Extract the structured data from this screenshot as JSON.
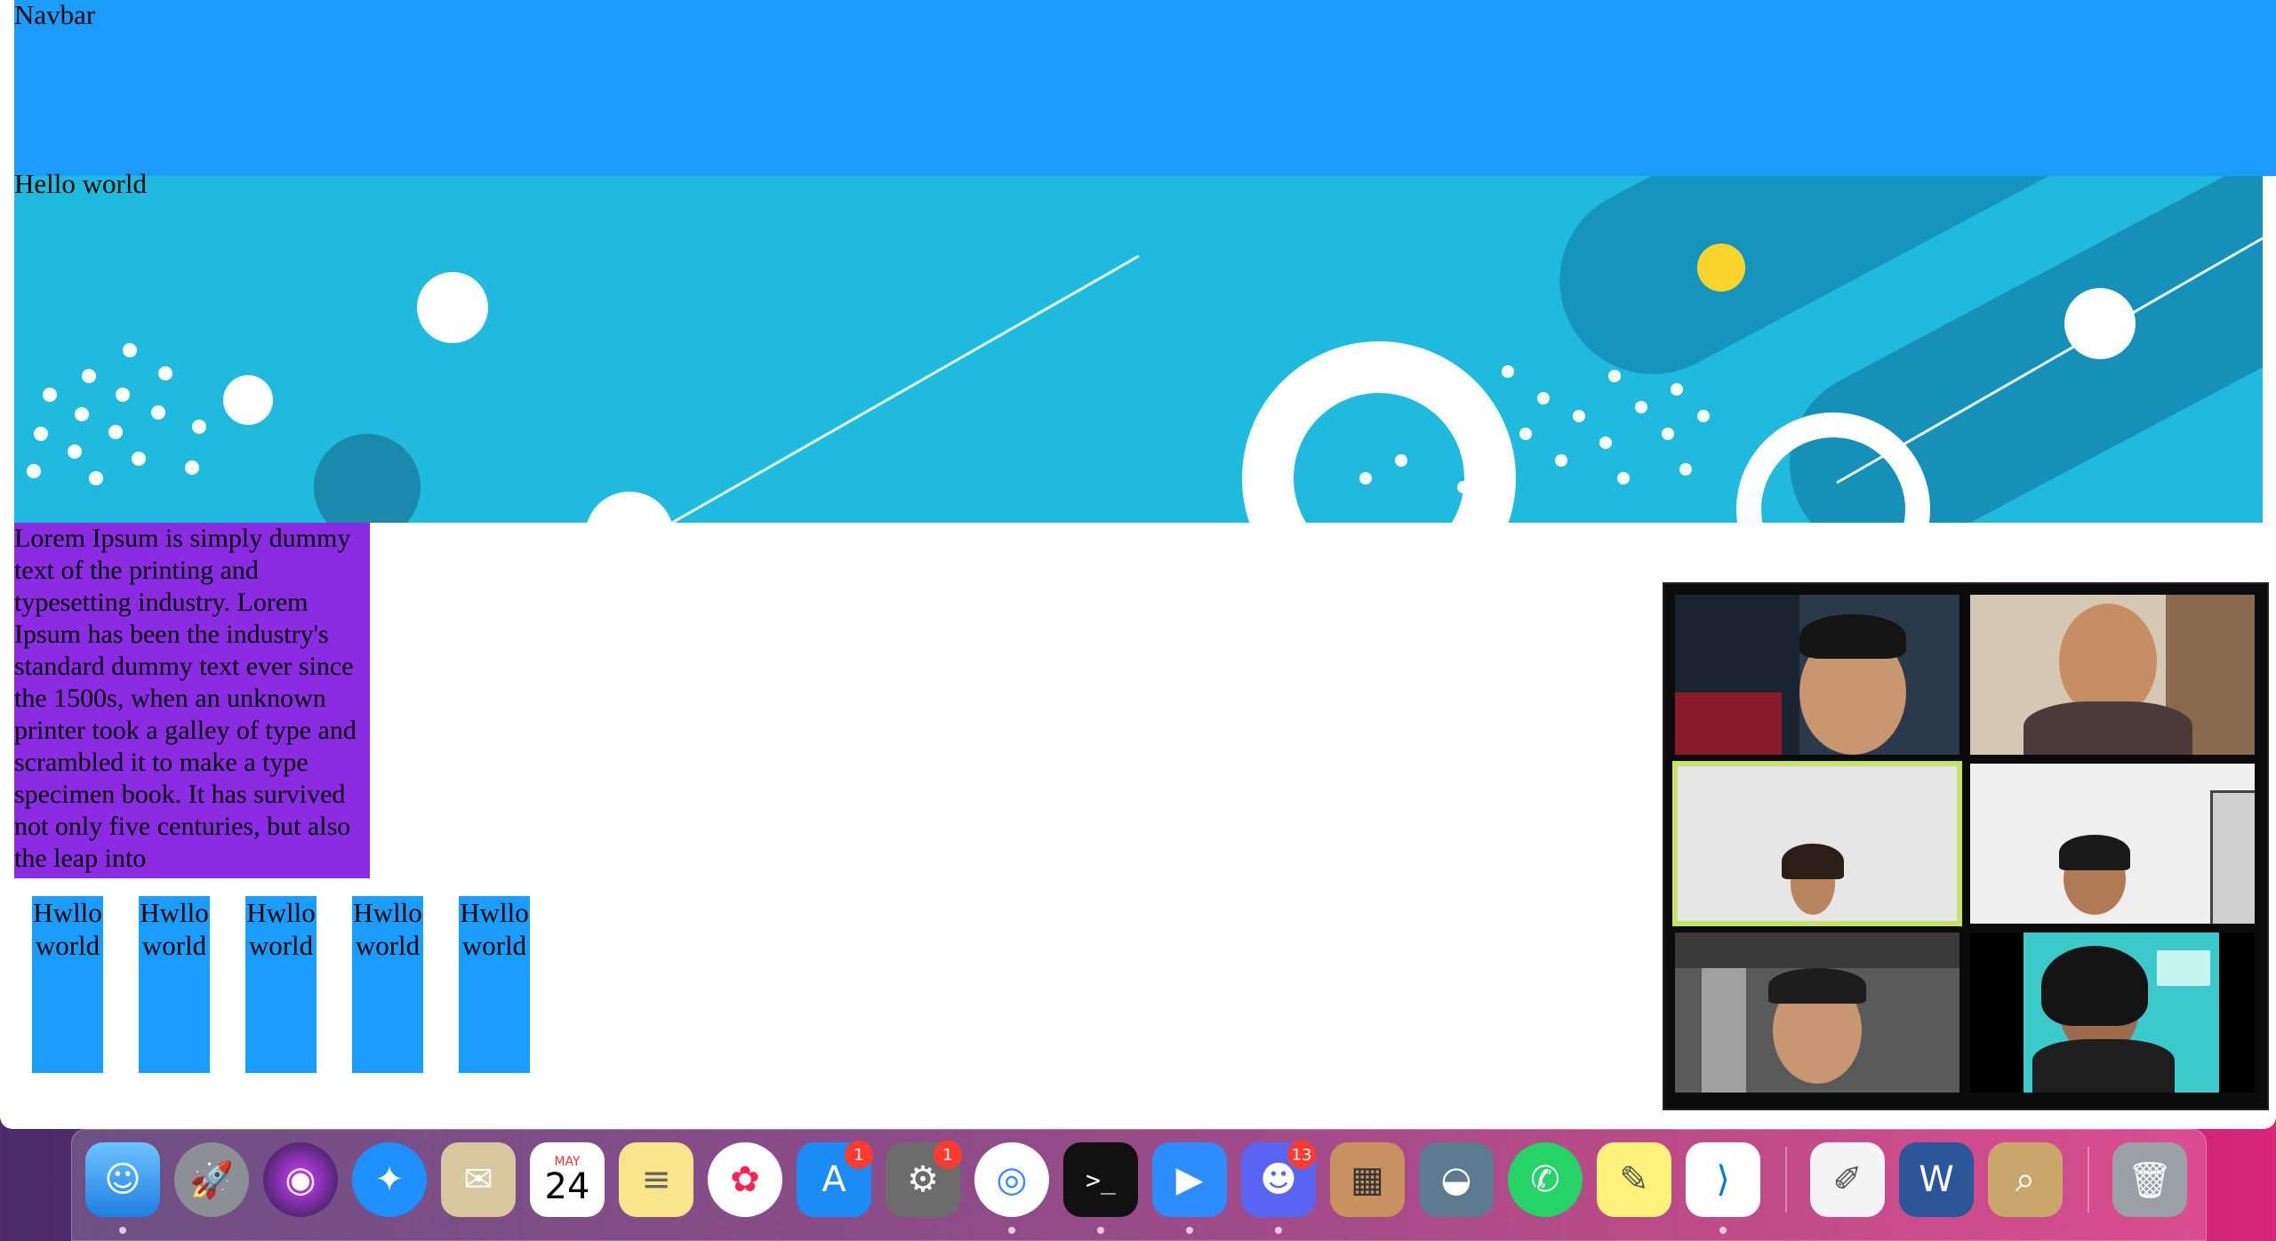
{
  "navbar": {
    "label": "Navbar"
  },
  "hero": {
    "caption": "Hello world"
  },
  "lorem": {
    "text": "Lorem Ipsum is simply dummy text of the printing and typesetting industry. Lorem Ipsum has been the industry's standard dummy text ever since the 1500s, when an unknown printer took a galley of type and scrambled it to make a type specimen book. It has survived not only five centuries, but also the leap into"
  },
  "boxes": [
    {
      "label": "Hwllo world"
    },
    {
      "label": "Hwllo world"
    },
    {
      "label": "Hwllo world"
    },
    {
      "label": "Hwllo world"
    },
    {
      "label": "Hwllo world"
    }
  ],
  "zoom": {
    "tiles": 6,
    "active_tile": 3
  },
  "dock": {
    "calendar": {
      "month": "MAY",
      "day": "24"
    },
    "badges": {
      "app_store": "1",
      "system_preferences": "1",
      "discord": "13"
    },
    "apps": [
      "Finder",
      "Launchpad",
      "Siri",
      "Safari",
      "Mail",
      "Calendar",
      "Notes",
      "Photos",
      "App Store",
      "System Preferences",
      "Chrome",
      "Terminal",
      "Zoom",
      "Discord",
      "Calculator",
      "Unknown App",
      "WhatsApp",
      "Stickies",
      "VS Code",
      "TextEdit",
      "Word",
      "Preview",
      "Trash"
    ]
  },
  "colors": {
    "navbar": "#1b9dff",
    "banner": "#1fbadd",
    "lorem_bg": "#8b2be2",
    "active_tile": "#c5e26a"
  }
}
